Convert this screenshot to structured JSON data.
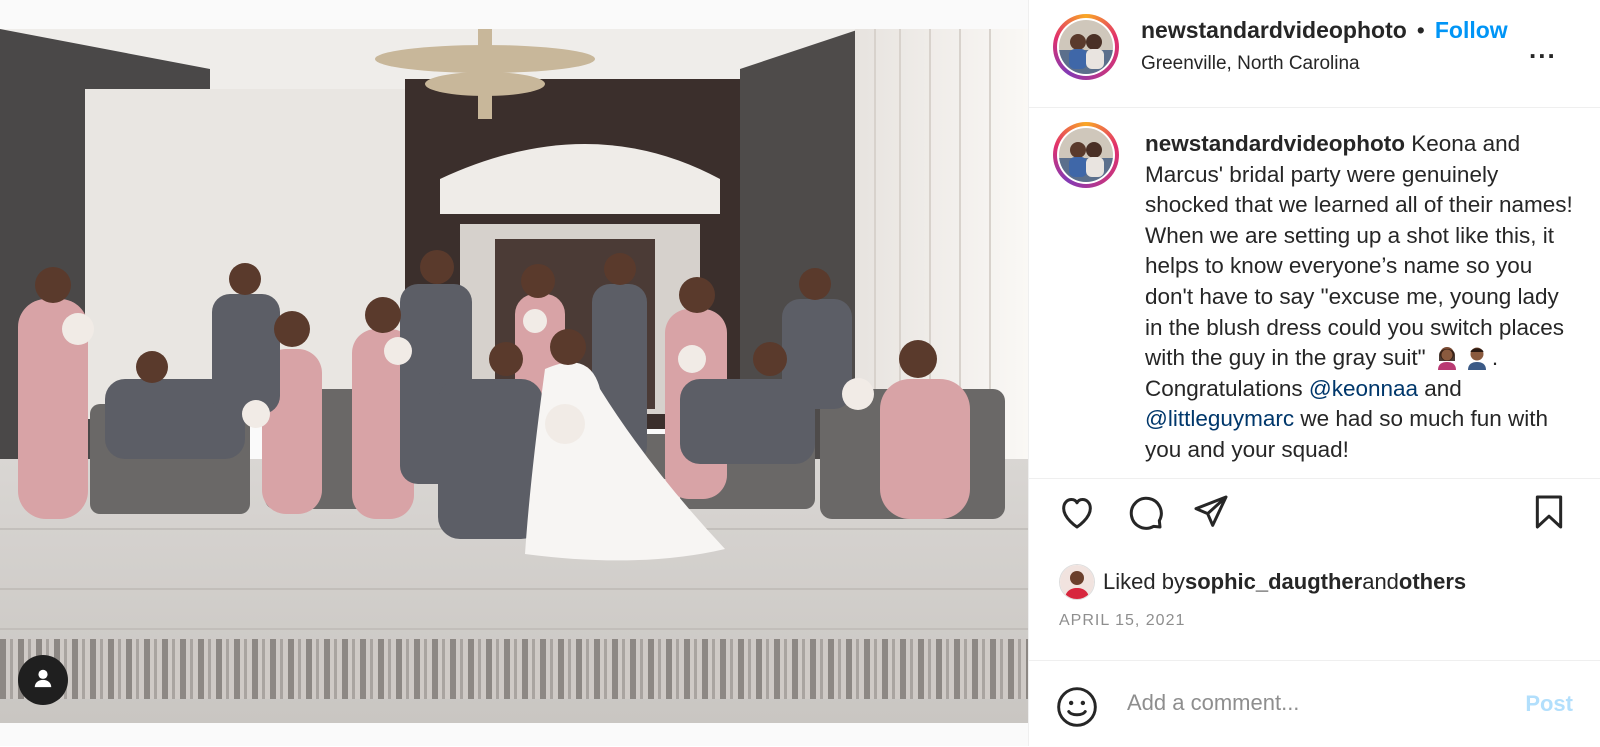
{
  "post": {
    "username": "newstandardvideophoto",
    "dot": "•",
    "follow_label": "Follow",
    "location": "Greenville, North Carolina",
    "more_label": "...",
    "photo_alt": "Bridal party portrait in hotel lobby"
  },
  "caption": {
    "username": "newstandardvideophoto",
    "text_before": " Keona and Marcus' bridal party were genuinely shocked that we learned all of their names! When we are setting up a shot like this, it helps to know everyone’s name so you don't have to say \"excuse me, young lady in the blush dress could you switch places with the guy in the gray suit\" ",
    "text_after_emoji": ". Congratulations ",
    "mention1": "@keonnaa",
    "and_text": " and ",
    "mention2": "@littleguymarc",
    "text_end": " we had so much fun with you and your squad!"
  },
  "likes": {
    "prefix": "Liked by ",
    "user": "sophic_daugther",
    "middle": " and ",
    "others": "others"
  },
  "date": "APRIL 15, 2021",
  "comment": {
    "placeholder": "Add a comment...",
    "post_label": "Post"
  },
  "icons": {
    "like": "heart-icon",
    "comment": "comment-icon",
    "share": "paper-plane-icon",
    "save": "bookmark-icon",
    "emoji": "smiley-icon",
    "user_tag": "person-icon"
  },
  "colors": {
    "accent": "#0095f6",
    "mention": "#00376b",
    "post_disabled": "#b2dffc",
    "muted": "#8e8e8e",
    "text": "#262626"
  }
}
